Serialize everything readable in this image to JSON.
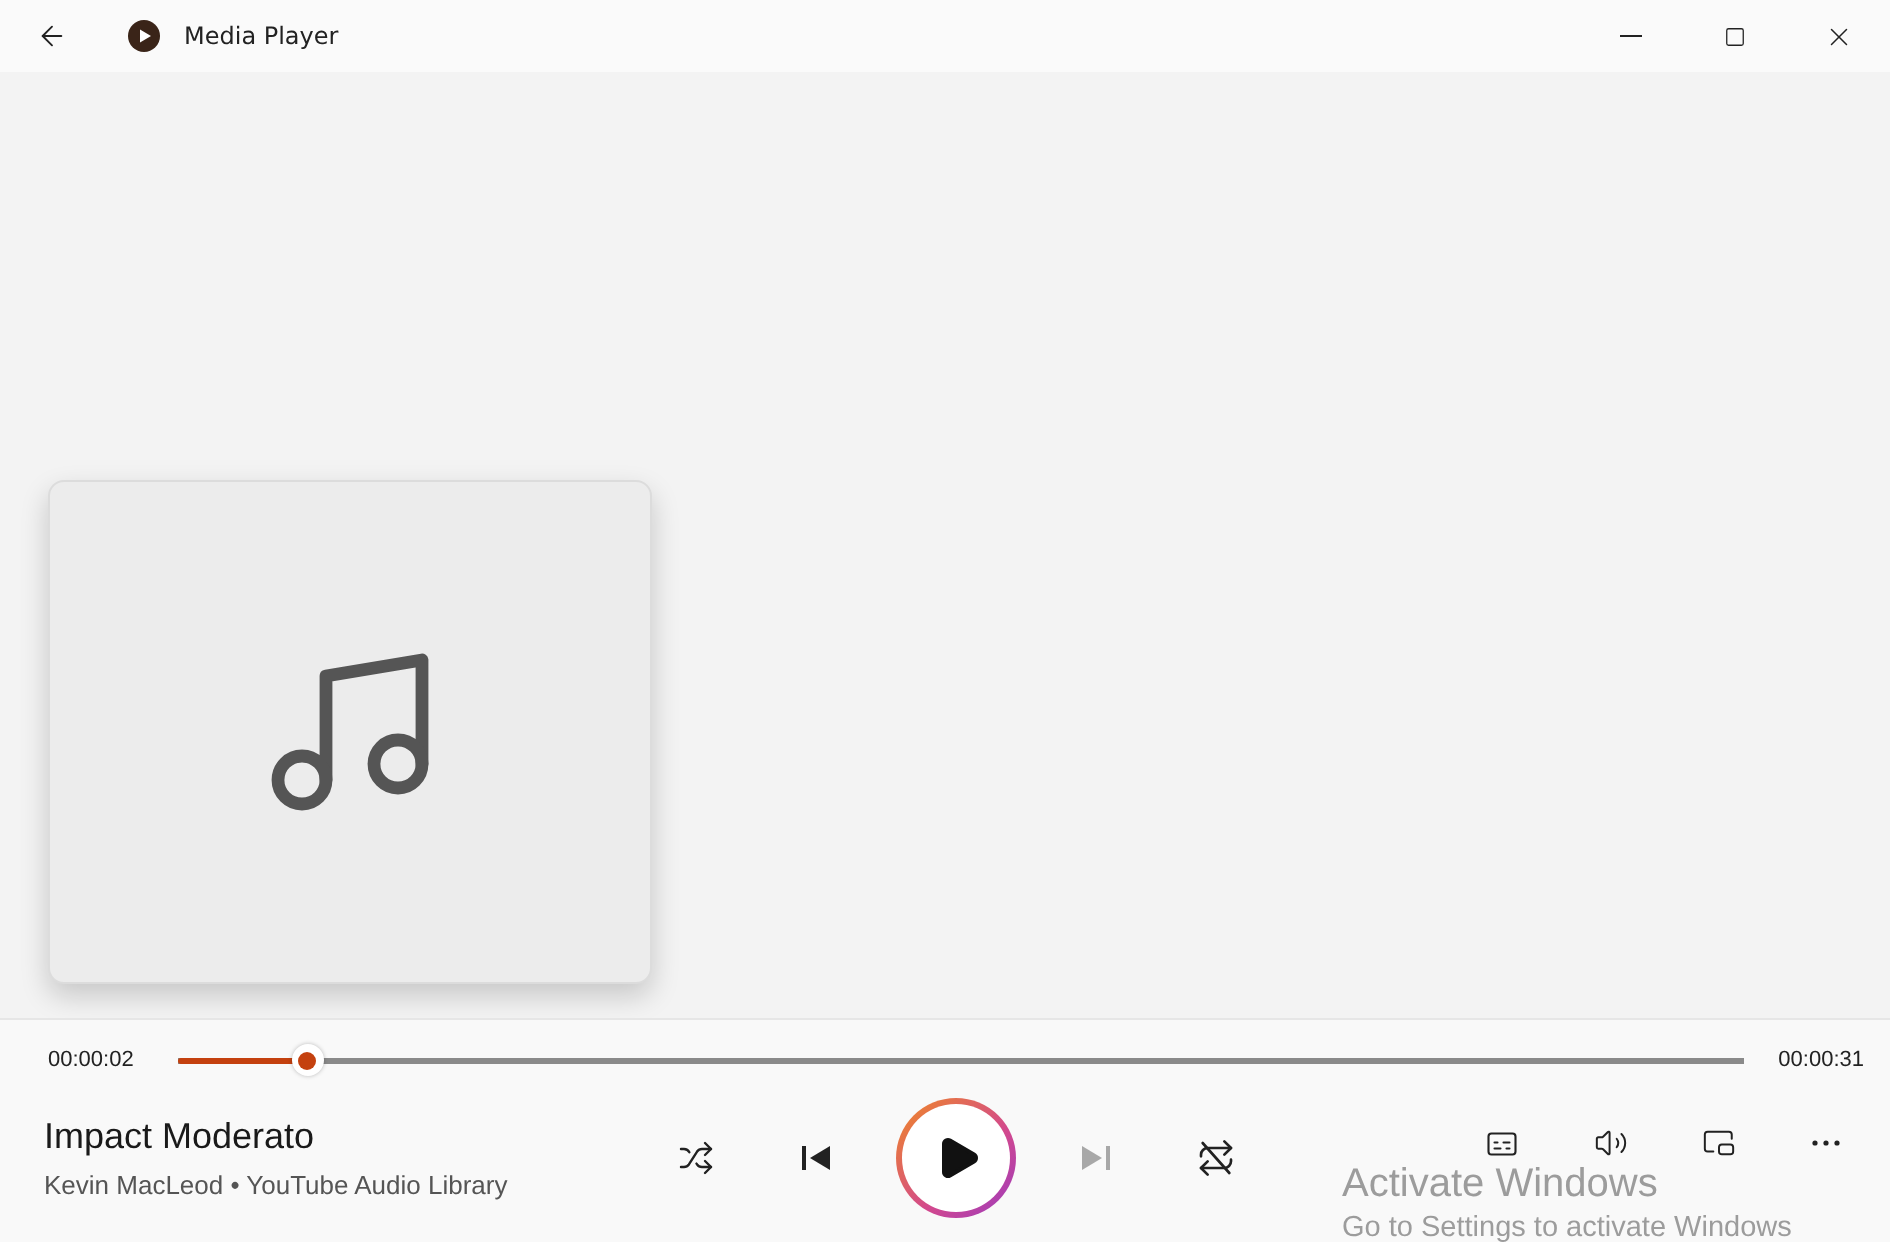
{
  "window": {
    "title": "Media Player"
  },
  "playback": {
    "elapsed": "00:00:02",
    "duration": "00:00:31",
    "level": 0.083
  },
  "track": {
    "title": "Impact Moderato",
    "subtitle": "Kevin MacLeod • YouTube Audio Library"
  },
  "controls": [
    {
      "kind": "shuffle",
      "disabled": false
    },
    {
      "kind": "previous",
      "disabled": false
    },
    {
      "kind": "play",
      "disabled": false
    },
    {
      "kind": "next",
      "disabled": true
    },
    {
      "kind": "repeat",
      "disabled": false,
      "on": false
    }
  ],
  "extra_controls": [
    {
      "kind": "captions"
    },
    {
      "kind": "volume"
    },
    {
      "kind": "mini-player"
    },
    {
      "kind": "more"
    }
  ],
  "watermark": {
    "title": "Activate Windows",
    "detail": "Go to Settings to activate Windows"
  }
}
